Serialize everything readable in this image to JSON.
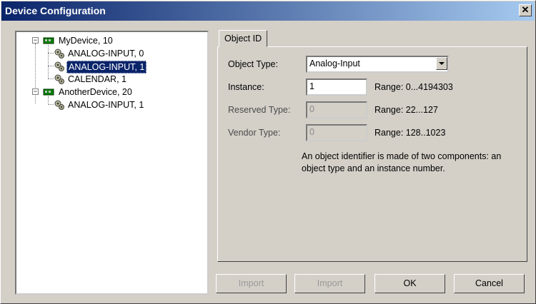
{
  "window": {
    "title": "Device Configuration",
    "close_glyph": "✕"
  },
  "tree": {
    "nodes": [
      {
        "label": "MyDevice, 10",
        "icon": "device-icon",
        "expander": "−"
      },
      {
        "label": "ANALOG-INPUT, 0",
        "icon": "gear-icon"
      },
      {
        "label": "ANALOG-INPUT, 1",
        "icon": "gear-icon",
        "selected": true
      },
      {
        "label": "CALENDAR, 1",
        "icon": "gear-icon"
      },
      {
        "label": "AnotherDevice, 20",
        "icon": "device-icon",
        "expander": "−"
      },
      {
        "label": "ANALOG-INPUT, 1",
        "icon": "gear-icon"
      }
    ]
  },
  "tabs": [
    {
      "label": "Object ID"
    }
  ],
  "form": {
    "object_type_label": "Object Type:",
    "object_type_value": "Analog-Input",
    "instance_label": "Instance:",
    "instance_value": "1",
    "instance_range": "Range: 0...4194303",
    "reserved_type_label": "Reserved Type:",
    "reserved_type_value": "0",
    "reserved_range": "Range: 22...127",
    "vendor_type_label": "Vendor Type:",
    "vendor_type_value": "0",
    "vendor_range": "Range: 128..1023",
    "description": "An object identifier is made of two components: an object type and an instance number."
  },
  "buttons": {
    "import1": "Import",
    "import2": "Import",
    "ok": "OK",
    "cancel": "Cancel"
  },
  "colors": {
    "selection": "#0a246a",
    "title_start": "#0a246a",
    "title_end": "#a6caf0",
    "face": "#d4d0c8"
  }
}
